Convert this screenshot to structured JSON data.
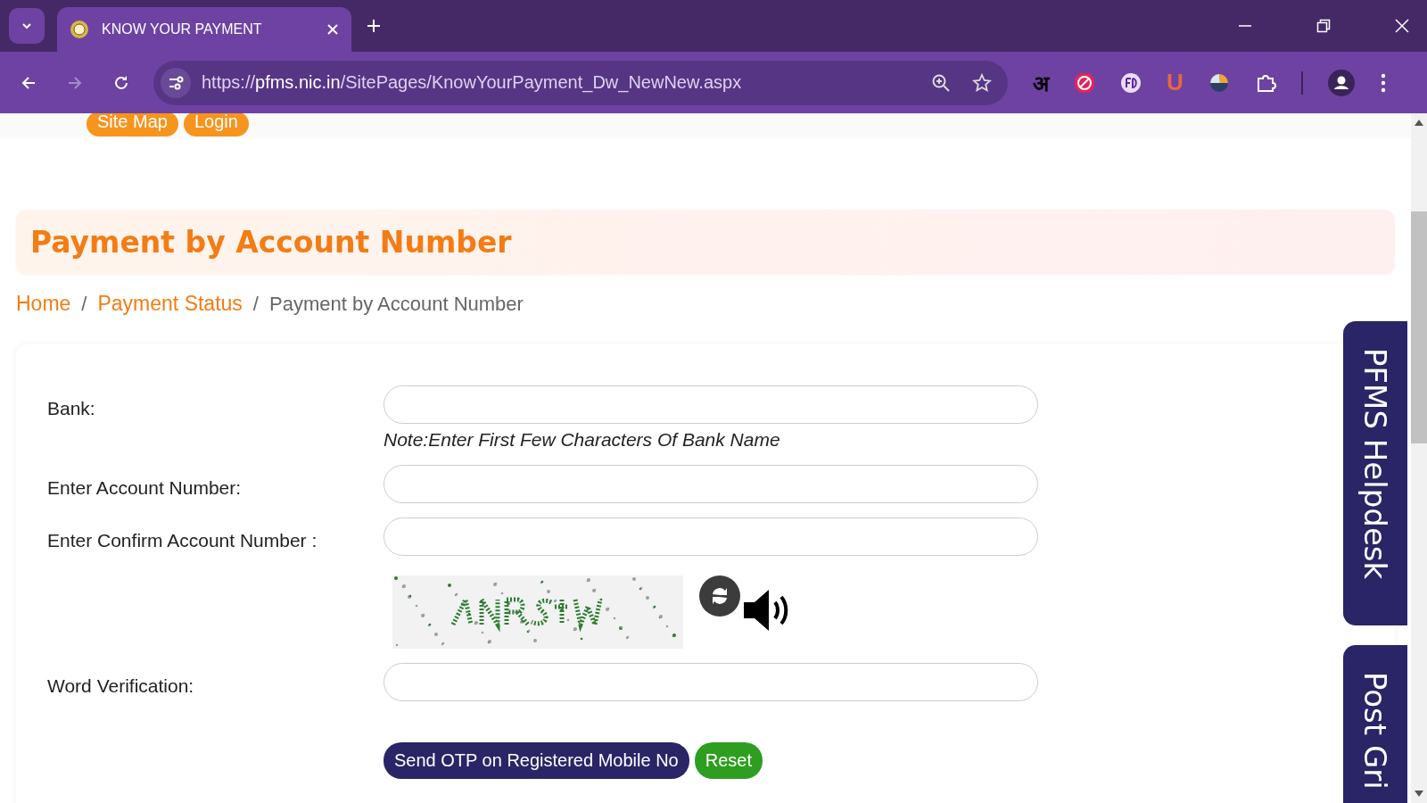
{
  "browser": {
    "tab_title": "KNOW YOUR PAYMENT",
    "url_scheme": "https://",
    "url_host": "pfms.nic.in",
    "url_path": "/SitePages/KnowYourPayment_Dw_NewNew.aspx",
    "extension_letters": [
      {
        "kind": "hindi",
        "text": "अ"
      },
      {
        "kind": "adblock"
      },
      {
        "kind": "fd"
      },
      {
        "kind": "letter",
        "text": "U"
      },
      {
        "kind": "ball"
      }
    ]
  },
  "top_links": [
    "Site Map",
    "Login"
  ],
  "heading": "Payment by Account Number",
  "breadcrumb": [
    {
      "label": "Home",
      "kind": "link"
    },
    {
      "label": "Payment Status",
      "kind": "link",
      "separator": "/"
    },
    {
      "label": "Payment by Account Number",
      "kind": "current",
      "separator": "/"
    }
  ],
  "form": {
    "rows": [
      {
        "kind": "input",
        "label": "Bank:",
        "note": "Note:Enter First Few Characters Of Bank Name"
      },
      {
        "kind": "input",
        "label": "Enter Account Number:"
      },
      {
        "kind": "input",
        "label": "Enter Confirm Account Number :"
      },
      {
        "kind": "captcha"
      },
      {
        "kind": "input",
        "label": "Word Verification:"
      }
    ],
    "buttons": [
      {
        "label": "Send OTP on Registered Mobile No",
        "kind": "primary"
      },
      {
        "label": "Reset",
        "kind": "secondary"
      }
    ]
  },
  "side_tabs": [
    "PFMS Helpdesk",
    "Post Gri"
  ]
}
